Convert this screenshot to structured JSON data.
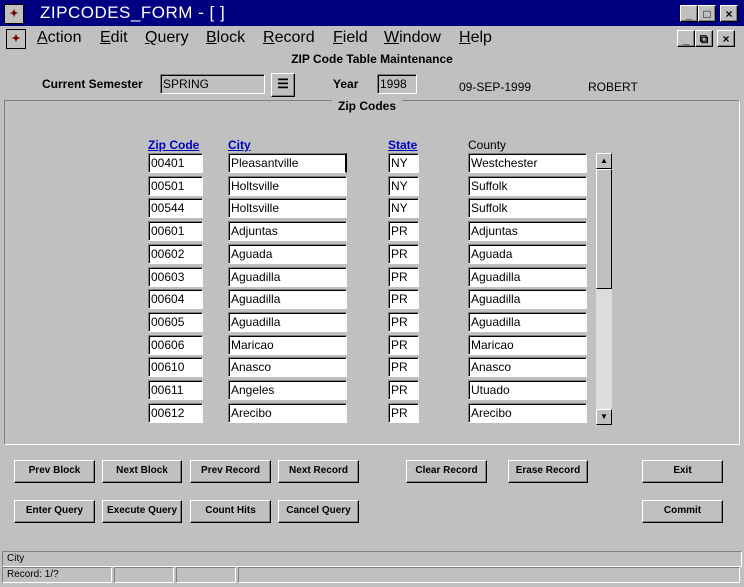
{
  "window": {
    "title": "ZIPCODES_FORM - [ ]",
    "app_icon": "oracle-forms-icon",
    "controls": [
      "_",
      "□",
      "×"
    ],
    "inner_controls": [
      "_",
      "⧉",
      "×"
    ]
  },
  "menu": [
    "Action",
    "Edit",
    "Query",
    "Block",
    "Record",
    "Field",
    "Window",
    "Help"
  ],
  "menu_underline": [
    "A",
    "E",
    "Q",
    "B",
    "R",
    "F",
    "W",
    "H"
  ],
  "form": {
    "title": "ZIP Code Table Maintenance",
    "semester_label": "Current Semester",
    "semester_value": "SPRING",
    "year_label": "Year",
    "year_value": "1998",
    "date": "09-SEP-1999",
    "user": "ROBERT",
    "block_title": "Zip Codes"
  },
  "table": {
    "headers": {
      "zip": "Zip Code",
      "city": "City",
      "state": "State",
      "county": "County"
    },
    "rows": [
      [
        "00401",
        "Pleasantville",
        "NY",
        "Westchester"
      ],
      [
        "00501",
        "Holtsville",
        "NY",
        "Suffolk"
      ],
      [
        "00544",
        "Holtsville",
        "NY",
        "Suffolk"
      ],
      [
        "00601",
        "Adjuntas",
        "PR",
        "Adjuntas"
      ],
      [
        "00602",
        "Aguada",
        "PR",
        "Aguada"
      ],
      [
        "00603",
        "Aguadilla",
        "PR",
        "Aguadilla"
      ],
      [
        "00604",
        "Aguadilla",
        "PR",
        "Aguadilla"
      ],
      [
        "00605",
        "Aguadilla",
        "PR",
        "Aguadilla"
      ],
      [
        "00606",
        "Maricao",
        "PR",
        "Maricao"
      ],
      [
        "00610",
        "Anasco",
        "PR",
        "Anasco"
      ],
      [
        "00611",
        "Angeles",
        "PR",
        "Utuado"
      ],
      [
        "00612",
        "Arecibo",
        "PR",
        "Arecibo"
      ]
    ]
  },
  "buttons": {
    "prev_block": "Prev Block",
    "next_block": "Next Block",
    "prev_record": "Prev Record",
    "next_record": "Next Record",
    "clear_record": "Clear Record",
    "erase_record": "Erase Record",
    "exit": "Exit",
    "enter_query": "Enter Query",
    "execute_query": "Execute Query",
    "count_hits": "Count Hits",
    "cancel_query": "Cancel Query",
    "commit": "Commit"
  },
  "status": {
    "hint": "City",
    "record": "Record: 1/?"
  }
}
